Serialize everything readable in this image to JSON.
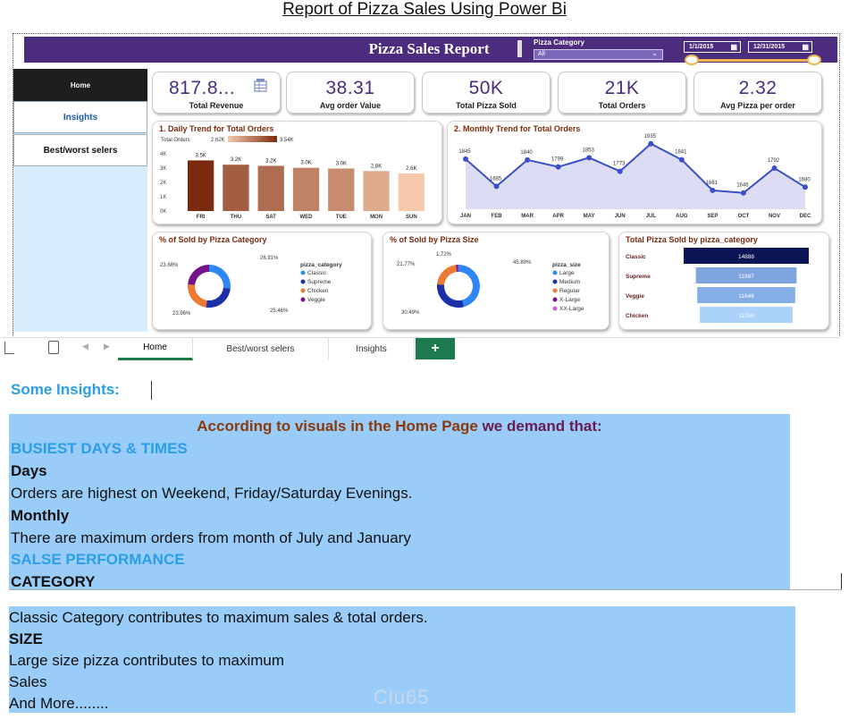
{
  "doc_title": "Report of Pizza Sales Using Power Bi",
  "report": {
    "title": "Pizza Sales Report",
    "slicer_label": "Pizza Category",
    "slicer_value": "All",
    "date_from": "1/1/2015",
    "date_to": "12/31/2015",
    "nav": [
      {
        "label": "Home"
      },
      {
        "label": "Insights"
      },
      {
        "label": "Best/worst selers"
      }
    ],
    "kpis": [
      {
        "value": "817.8...",
        "label": "Total Revenue"
      },
      {
        "value": "38.31",
        "label": "Avg order Value"
      },
      {
        "value": "50K",
        "label": "Total Pizza Sold"
      },
      {
        "value": "21K",
        "label": "Total Orders"
      },
      {
        "value": "2.32",
        "label": "Avg Pizza per order"
      }
    ],
    "tabs": [
      {
        "label": "Home"
      },
      {
        "label": "Best/worst selers"
      },
      {
        "label": "Insights"
      }
    ],
    "add_tab": "+"
  },
  "chart_data": [
    {
      "type": "bar",
      "title": "1. Daily Trend for Total Orders",
      "legend_title": "Total Orders",
      "legend_min": "2.62K",
      "legend_max": "3.54K",
      "categories": [
        "FRI",
        "THU",
        "SAT",
        "WED",
        "TUE",
        "MON",
        "SUN"
      ],
      "values": [
        3538,
        3239,
        3158,
        3024,
        2973,
        2794,
        2624
      ],
      "data_labels": [
        "3.5K",
        "3.2K",
        "3.2K",
        "3.0K",
        "3.0K",
        "2.8K",
        "2.6K"
      ],
      "yticks": [
        "0K",
        "1K",
        "2K",
        "3K",
        "4K"
      ],
      "ylim": [
        0,
        4000
      ]
    },
    {
      "type": "area",
      "title": "2. Monthly Trend for Total Orders",
      "categories": [
        "JAN",
        "FEB",
        "MAR",
        "APR",
        "MAY",
        "JUN",
        "JUL",
        "AUG",
        "SEP",
        "OCT",
        "NOV",
        "DEC"
      ],
      "values": [
        1845,
        1685,
        1840,
        1799,
        1853,
        1773,
        1935,
        1841,
        1661,
        1646,
        1792,
        1680
      ],
      "labels": [
        "1845",
        "1685",
        "1840",
        "1799",
        "1853",
        "1773",
        "1935",
        "1841",
        "1661",
        "1646",
        "1792",
        "1680"
      ],
      "color": "#3b50c4"
    },
    {
      "type": "pie",
      "title": "% of Sold by Pizza Category",
      "legend_title": "pizza_category",
      "slices": [
        {
          "name": "Classic",
          "value": 26.91,
          "label": "26.91%",
          "color": "#2f86f6"
        },
        {
          "name": "Supreme",
          "value": 25.46,
          "label": "25.46%",
          "color": "#1b2fa8"
        },
        {
          "name": "Chicken",
          "value": 23.96,
          "label": "23.96%",
          "color": "#ec7a32"
        },
        {
          "name": "Veggie",
          "value": 23.68,
          "label": "23.68%",
          "color": "#74128a"
        }
      ]
    },
    {
      "type": "pie",
      "title": "% of Sold by Pizza Size",
      "legend_title": "pizza_size",
      "slices": [
        {
          "name": "Large",
          "value": 45.89,
          "label": "45.89%",
          "color": "#2f86f6"
        },
        {
          "name": "Medium",
          "value": 30.49,
          "label": "30.49%",
          "color": "#1b2fa8"
        },
        {
          "name": "Regular",
          "value": 21.77,
          "label": "21.77%",
          "color": "#ec7a32"
        },
        {
          "name": "X-Large",
          "value": 1.72,
          "label": "1.72%",
          "color": "#74128a"
        },
        {
          "name": "XX-Large",
          "value": 0.12,
          "label": "",
          "color": "#d35fd4"
        }
      ]
    },
    {
      "type": "bar",
      "title": "Total Pizza Sold by pizza_category",
      "orientation": "horizontal",
      "categories": [
        "Classic",
        "Supreme",
        "Veggie",
        "Chicken"
      ],
      "values": [
        14888,
        11987,
        11649,
        11050
      ],
      "colors": [
        "#0b1454",
        "#7fa4de",
        "#85aee6",
        "#aad2fb"
      ],
      "xlim": [
        0,
        14888
      ]
    }
  ],
  "insights": {
    "heading": "Some Insights:",
    "intro_a": "According to visuals in the Home Page ",
    "intro_b": "we demand that:",
    "sec1": "BUSIEST DAYS & TIMES",
    "days_h": "Days",
    "days_t": "Orders are highest on Weekend, Friday/Saturday Evenings.",
    "month_h": "Monthly",
    "month_t": "There are maximum orders from month of July and January",
    "sec2": "SALSE PERFORMANCE",
    "cat_h": "CATEGORY",
    "cat_t": "Classic Category contributes to maximum sales & total orders.",
    "size_h": "SIZE",
    "size_t1": "Large size pizza contributes to maximum",
    "size_t2": "Sales",
    "more": "And More........"
  },
  "watermark": "Clu65"
}
